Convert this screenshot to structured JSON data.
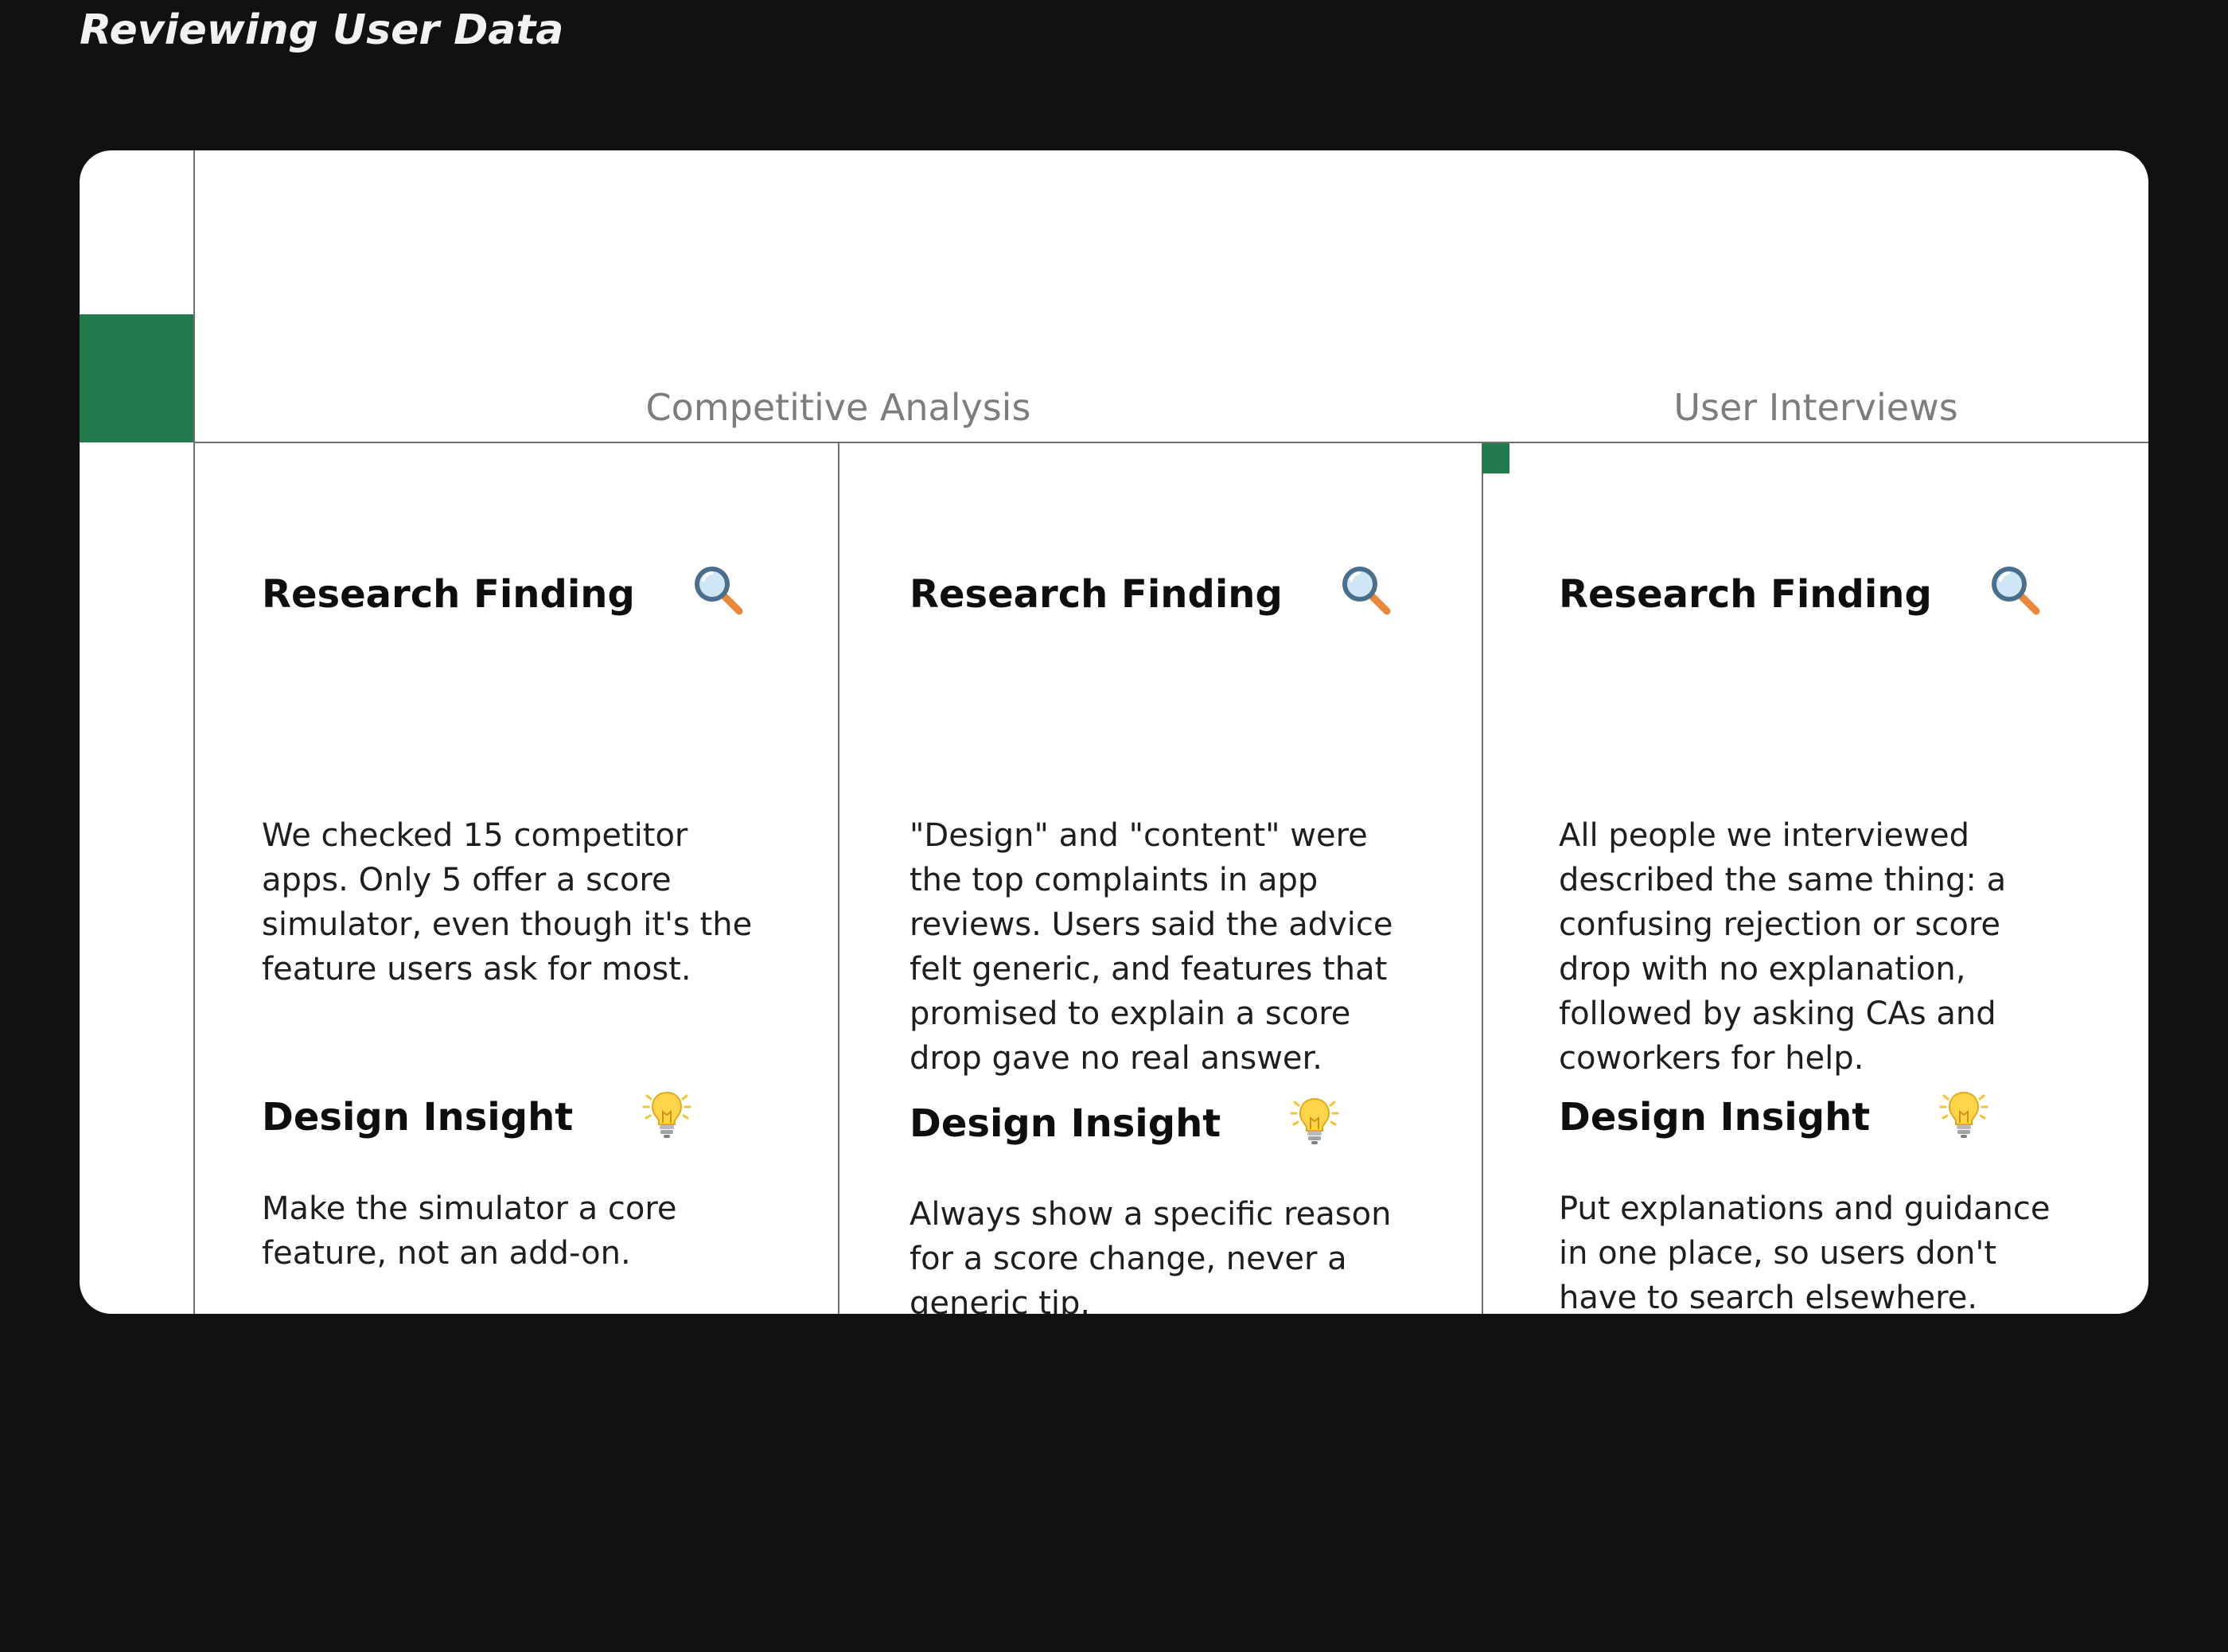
{
  "page": {
    "title": "Reviewing User Data"
  },
  "headers": {
    "competitive": "Competitive Analysis",
    "interviews": "User Interviews"
  },
  "columns": [
    {
      "finding_title": "Research Finding",
      "finding_icon": "magnifying-glass-icon",
      "finding_text": "We checked 15 competitor apps. Only 5 offer a score simulator, even though it's the feature users ask for most.",
      "insight_title": "Design Insight",
      "insight_icon": "light-bulb-icon",
      "insight_text": "Make the simulator a core feature, not an add-on."
    },
    {
      "finding_title": "Research Finding",
      "finding_icon": "magnifying-glass-icon",
      "finding_text": "\"Design\" and \"content\" were the top complaints in app reviews. Users said the advice felt generic, and features that promised to explain a score drop gave no real answer.",
      "insight_title": "Design Insight",
      "insight_icon": "light-bulb-icon",
      "insight_text": "Always show a specific reason for a score change, never a generic tip."
    },
    {
      "finding_title": "Research Finding",
      "finding_icon": "magnifying-glass-icon",
      "finding_text": "All people we interviewed described the same thing: a confusing rejection or score drop with no explanation, followed by asking CAs and coworkers for help.",
      "insight_title": "Design Insight",
      "insight_icon": "light-bulb-icon",
      "insight_text": "Put explanations and guidance in one place, so users don't have to search elsewhere."
    }
  ],
  "colors": {
    "background": "#111111",
    "card": "#ffffff",
    "accent": "#217a4c",
    "divider": "#6f6f6f",
    "header_text": "#7d7d7d"
  }
}
